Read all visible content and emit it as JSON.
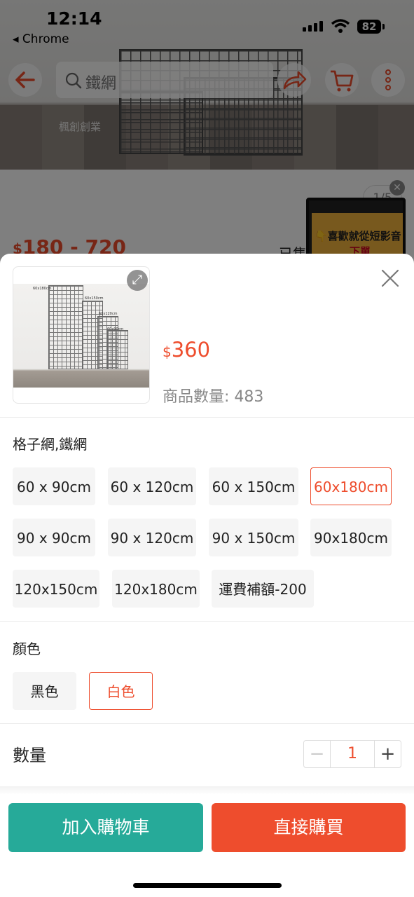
{
  "status_bar": {
    "time": "12:14",
    "back_app": "◂ Chrome",
    "battery": "82"
  },
  "header": {
    "search_placeholder": "鐵網"
  },
  "background_page": {
    "image_counter": "1/5",
    "price_currency": "$",
    "price_range": "180 - 720",
    "sold_label": "已售",
    "hero_logo_text": "楓創創業",
    "video_text": "👇喜歡就從短影音",
    "video_subtext": "下單"
  },
  "sheet": {
    "thumbnail_labels": [
      "60x180cm",
      "60x150cm",
      "60x120cm",
      "60x90cm"
    ],
    "price_currency": "$",
    "price": "360",
    "stock_label": "商品數量: 483",
    "variation_title": "格子網,鐵網",
    "size_options": [
      {
        "label": "60 x 90cm",
        "selected": false
      },
      {
        "label": "60 x 120cm",
        "selected": false
      },
      {
        "label": "60 x 150cm",
        "selected": false
      },
      {
        "label": "60x180cm",
        "selected": true
      },
      {
        "label": "90 x 90cm",
        "selected": false
      },
      {
        "label": "90 x 120cm",
        "selected": false
      },
      {
        "label": "90 x 150cm",
        "selected": false
      },
      {
        "label": "90x180cm",
        "selected": false
      },
      {
        "label": "120x150cm",
        "selected": false
      },
      {
        "label": "120x180cm",
        "selected": false
      },
      {
        "label": "運費補額-200",
        "selected": false
      }
    ],
    "color_title": "顏色",
    "color_options": [
      {
        "label": "黑色",
        "selected": false
      },
      {
        "label": "白色",
        "selected": true
      }
    ],
    "quantity_label": "數量",
    "quantity_value": "1",
    "minus_symbol": "−",
    "plus_symbol": "+",
    "close_symbol": "✕",
    "expand_symbol": "⤢"
  },
  "footer": {
    "add_to_cart": "加入購物車",
    "buy_now": "直接購買"
  },
  "colors": {
    "accent": "#ee4d2d",
    "cart_button": "#26aa99"
  },
  "icons": [
    "back-arrow-icon",
    "search-icon",
    "share-icon",
    "cart-icon",
    "more-icon",
    "expand-icon",
    "close-icon",
    "minus-icon",
    "plus-icon"
  ]
}
